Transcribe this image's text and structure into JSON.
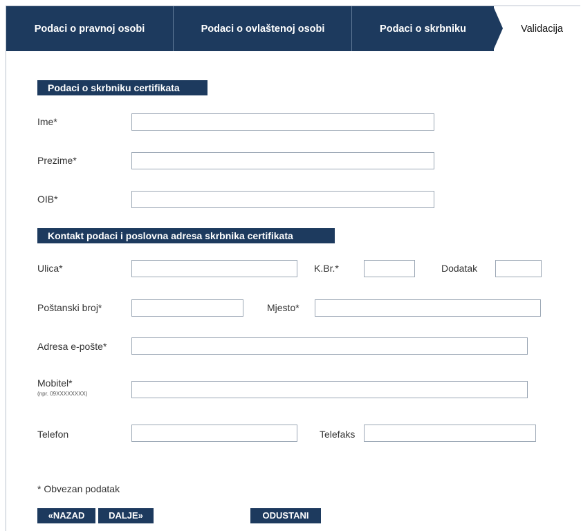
{
  "tabs": [
    {
      "label": "Podaci o pravnoj osobi",
      "active": false
    },
    {
      "label": "Podaci o ovlaštenoj osobi",
      "active": false
    },
    {
      "label": "Podaci o skrbniku",
      "active": false
    },
    {
      "label": "Validacija",
      "active": true
    }
  ],
  "section1": {
    "title": "Podaci o skrbniku certifikata"
  },
  "section2": {
    "title": "Kontakt podaci i poslovna adresa skrbnika certifikata"
  },
  "fields": {
    "ime": {
      "label": "Ime*",
      "value": ""
    },
    "prezime": {
      "label": "Prezime*",
      "value": ""
    },
    "oib": {
      "label": "OIB*",
      "value": ""
    },
    "ulica": {
      "label": "Ulica*",
      "value": ""
    },
    "kbr": {
      "label": "K.Br.*",
      "value": ""
    },
    "dodatak": {
      "label": "Dodatak",
      "value": ""
    },
    "postanski": {
      "label": "Poštanski broj*",
      "value": ""
    },
    "mjesto": {
      "label": "Mjesto*",
      "value": ""
    },
    "email": {
      "label": "Adresa e-pošte*",
      "value": ""
    },
    "mobitel": {
      "label": "Mobitel*",
      "hint": "(npr. 09XXXXXXXX)",
      "value": ""
    },
    "telefon": {
      "label": "Telefon",
      "value": ""
    },
    "telefaks": {
      "label": "Telefaks",
      "value": ""
    }
  },
  "note": "* Obvezan podatak",
  "buttons": {
    "back": "«NAZAD",
    "next": "DALJE»",
    "cancel": "ODUSTANI"
  },
  "colors": {
    "navy": "#1d3a5e",
    "border": "#9aa6b4"
  }
}
